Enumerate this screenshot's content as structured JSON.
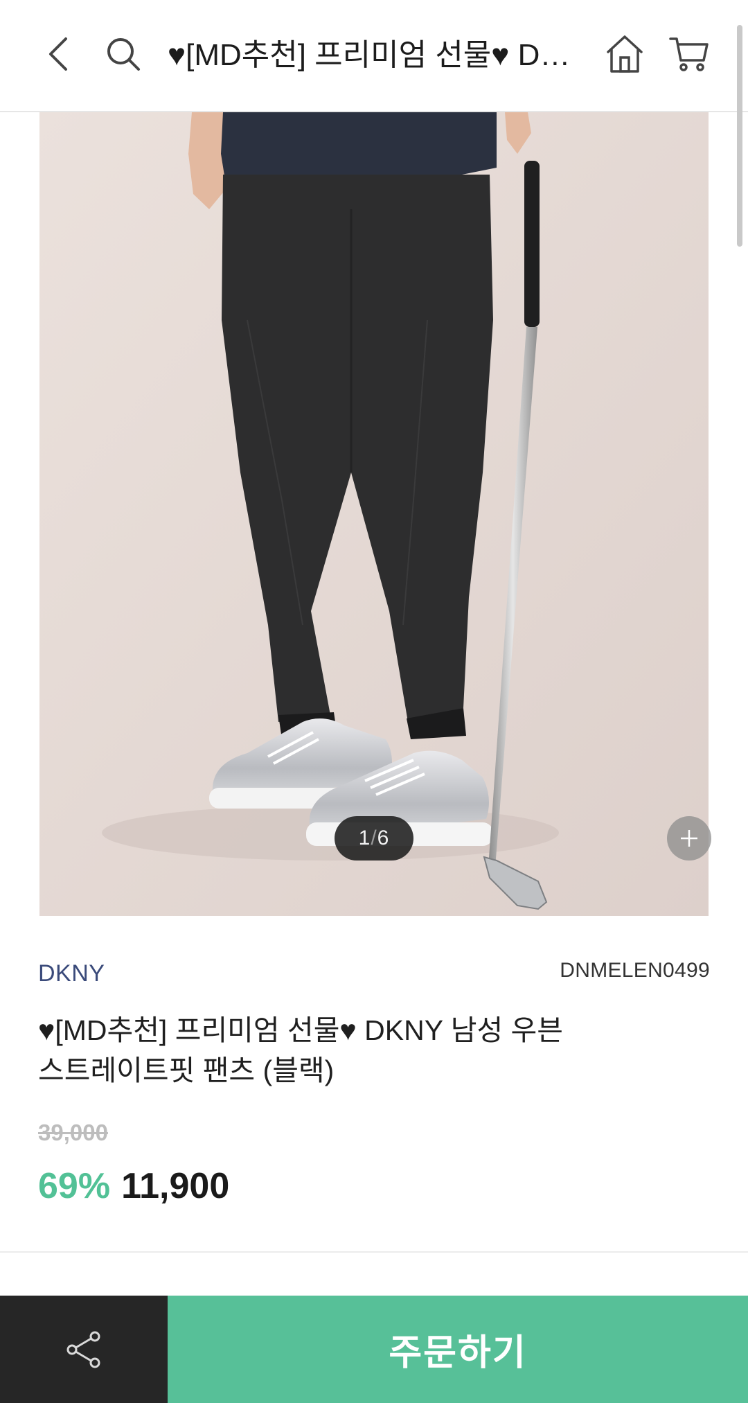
{
  "header": {
    "title": "♥[MD추천] 프리미엄 선물♥ DKNY 남성 우븐 스트레이트핏 팬츠 (블랙)",
    "back_icon": "chevron-left-icon",
    "search_icon": "search-icon",
    "home_icon": "home-icon",
    "cart_icon": "cart-icon"
  },
  "gallery": {
    "current": "1",
    "separator": "/",
    "total": "6"
  },
  "product": {
    "brand": "DKNY",
    "code": "DNMELEN0499",
    "name_line1": "♥[MD추천] 프리미엄 선물♥ DKNY 남성 우븐",
    "name_line2": "스트레이트핏 팬츠 (블랙)",
    "original_price": "39,000",
    "discount_rate": "69%",
    "sale_price": "11,900"
  },
  "bottom_bar": {
    "share_icon": "share-icon",
    "order_label": "주문하기"
  },
  "colors": {
    "accent": "#57c098",
    "brand_text": "#3a4a7a",
    "dark_bar": "#262626"
  }
}
